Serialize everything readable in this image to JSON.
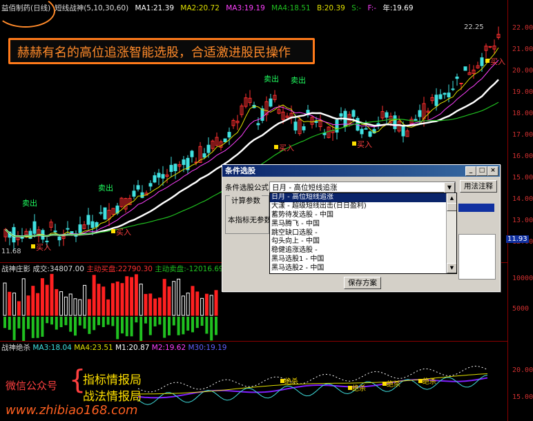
{
  "main_chart": {
    "stock_name": "益佰制药(日线)",
    "indicator": "短线战神",
    "params": "(5,10,30,60)",
    "ma1": "MA1:21.39",
    "ma2": "MA2:20.72",
    "ma3": "MA3:19.19",
    "ma4": "MA4:18.51",
    "b_val": "B:20.39",
    "s_val": "S:-",
    "f_val": "F:-",
    "year_val": "年:19.69",
    "high_label": "22.25",
    "low_label": "11.68",
    "price_tag": "11.93",
    "y_ticks": [
      "22.00",
      "21.00",
      "20.00",
      "19.00",
      "18.00",
      "17.00",
      "16.00",
      "15.00",
      "14.00",
      "13.00",
      "12.00"
    ],
    "sell_labels": [
      "卖出",
      "卖出",
      "卖出",
      "卖出"
    ],
    "buy_labels": [
      "买入",
      "买入",
      "买入",
      "买入",
      "买入"
    ],
    "colors": {
      "up": "#ff3030",
      "down": "#40e0e0",
      "ma1": "#ffffff",
      "ma2": "#e0e000",
      "ma3": "#ff40ff",
      "ma4": "#20c020",
      "axis": "#d03030"
    }
  },
  "banner": {
    "text": "赫赫有名的高位追涨智能选股，合适激进股民操作"
  },
  "volume_panel": {
    "title": "战神庄影",
    "volume": "成交:34807.00",
    "active_buy": "主动买盘:22790.30",
    "active_sell": "主动卖盘:-12016.69",
    "y_ticks": [
      "10000",
      "5000"
    ]
  },
  "lower_panel": {
    "title": "战神绝杀",
    "ma3": "MA3:18.04",
    "ma4": "MA4:23.51",
    "m1": "M1:20.87",
    "m2": "M2:19.62",
    "m30": "M30:19.19",
    "y_ticks": [
      "20.00",
      "15.00"
    ],
    "kill_labels": [
      "绝杀",
      "绝杀",
      "绝杀",
      "绝杀"
    ]
  },
  "watermark": {
    "wechat": "微信公众号",
    "brace": "{",
    "line1": "指标情报局",
    "line2": "战法情报局",
    "url": "www.zhibiao168.com"
  },
  "dialog": {
    "title": "条件选股",
    "formula_label": "条件选股公式",
    "selected_formula": "日月    - 高位短线追涨",
    "usage_button": "用法注释",
    "params_label": "计算参数",
    "no_param_label": "本指标无参数",
    "save_button": "保存方案",
    "minimize": "_",
    "maximize": "□",
    "close": "×",
    "options": [
      "日月          - 高位短线追涨",
      "大漾          - 超级短线出击(日日盈利)",
      "蓄势待发选股 - 中国",
      "黑马腾飞  - 中国",
      "跳空缺口选股 -",
      "勾头向上  - 中国",
      "稳健追涨选股 -",
      "黑马选股1  - 中国",
      "黑马选股2  - 中国"
    ]
  }
}
